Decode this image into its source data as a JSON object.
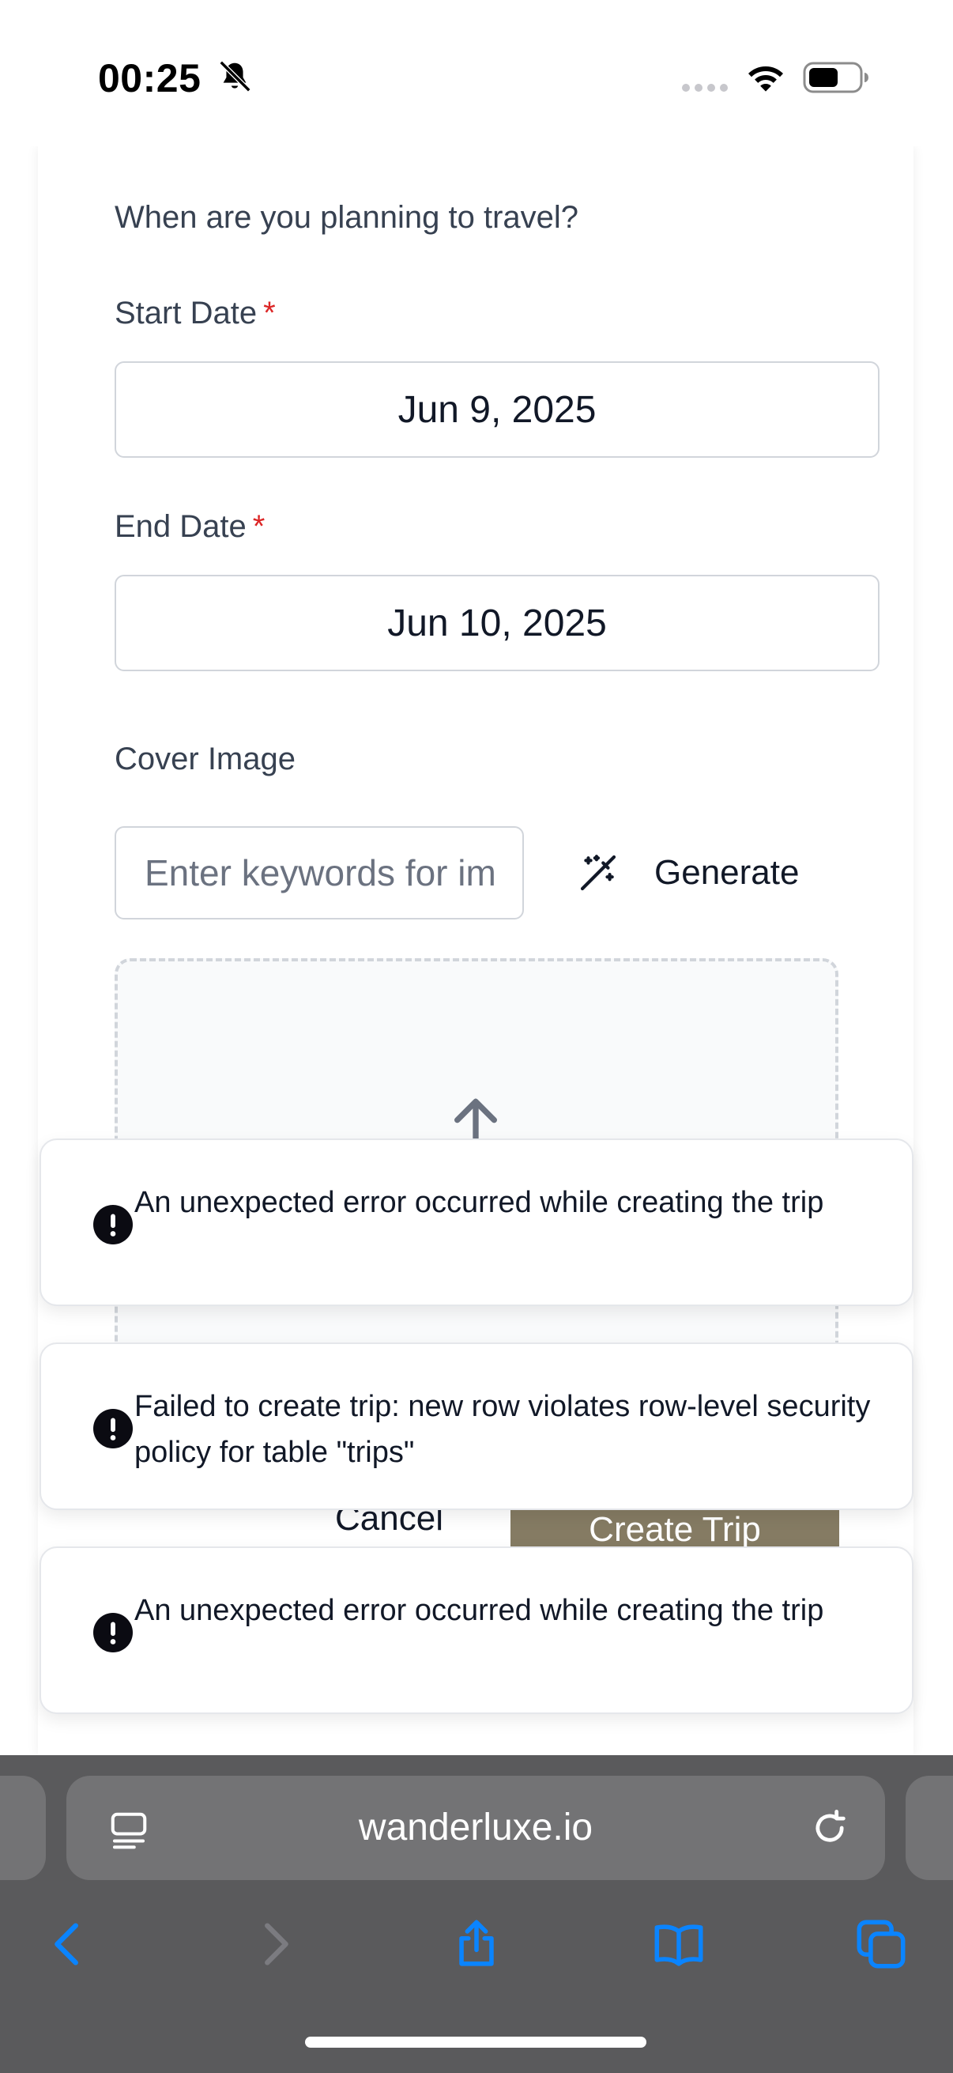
{
  "status_bar": {
    "time": "00:25"
  },
  "form": {
    "prompt": "When are you planning to travel?",
    "start_date_label": "Start Date",
    "start_date_value": "Jun 9, 2025",
    "end_date_label": "End Date",
    "end_date_value": "Jun 10, 2025",
    "required_marker": "*",
    "cover_image_label": "Cover Image",
    "keyword_placeholder": "Enter keywords for image",
    "generate_label": "Generate",
    "cancel_label": "Cancel",
    "create_label": "Create Trip"
  },
  "toasts": [
    {
      "message": "An unexpected error occurred while creating the trip"
    },
    {
      "message": "Failed to create trip: new row violates row-level security policy for table \"trips\""
    },
    {
      "message": "An unexpected error occurred while creating the trip"
    }
  ],
  "browser": {
    "url": "wanderluxe.io"
  },
  "colors": {
    "accent_button": "#857b63",
    "required": "#dc2626",
    "ios_blue": "#0a84ff",
    "browser_bar": "#5a5a5c"
  },
  "icons": [
    "bell-slash-icon",
    "signal-dots-icon",
    "wifi-icon",
    "battery-icon",
    "magic-wand-icon",
    "upload-icon",
    "error-icon",
    "reader-icon",
    "reload-icon",
    "back-icon",
    "forward-icon",
    "share-icon",
    "bookmarks-icon",
    "tabs-icon"
  ]
}
